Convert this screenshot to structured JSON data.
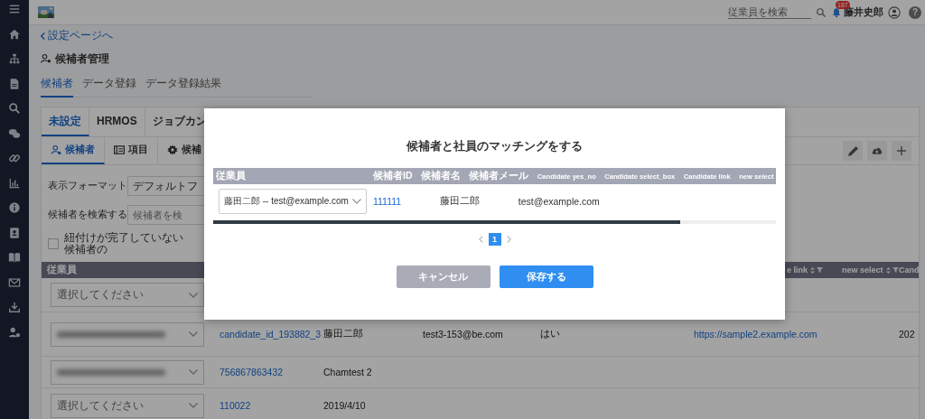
{
  "topbar": {
    "search_placeholder": "従業員を検索",
    "notification_count": "187",
    "user_name": "藤井史郎",
    "help": "?"
  },
  "back_link": "設定ページへ",
  "page_title": "候補者管理",
  "tabs": [
    {
      "label": "候補者",
      "selected": true
    },
    {
      "label": "データ登録",
      "selected": false
    },
    {
      "label": "データ登録結果",
      "selected": false
    }
  ],
  "source_tabs": [
    {
      "label": "未設定",
      "selected": true
    },
    {
      "label": "HRMOS",
      "selected": false
    },
    {
      "label": "ジョブカン",
      "selected": false
    }
  ],
  "view_tabs": [
    {
      "label": "候補者",
      "kind": "person",
      "selected": true
    },
    {
      "label": "項目",
      "kind": "list",
      "selected": false
    },
    {
      "label": "候補",
      "kind": "gear",
      "selected": false
    }
  ],
  "form": {
    "format_label": "表示フォーマット",
    "format_value": "デフォルトフ",
    "search_label": "候補者を検索する",
    "search_placeholder": "候補者を検",
    "unlinked_filter": {
      "label": "紐付けが完了していない候補者の",
      "checked": false
    }
  },
  "table": {
    "columns": [
      {
        "label": "従業員",
        "sortable": false
      },
      {
        "label": "e link",
        "sortable": true
      },
      {
        "label": "new select",
        "sortable": true
      },
      {
        "label": "Cand",
        "sortable": false
      }
    ],
    "rows": [
      {
        "employee": {
          "kind": "placeholder",
          "text": "選択してください"
        }
      },
      {
        "employee": {
          "kind": "redacted"
        },
        "candidate_id": "candidate_id_193882_3",
        "candidate_name": "藤田二郎",
        "candidate_email": "test3-153@be.com",
        "yes_no": "はい",
        "link": "https://sample2.example.com",
        "column_9": "202"
      },
      {
        "employee": {
          "kind": "redacted"
        },
        "candidate_id": "756867863432",
        "candidate_name": "Chamtest 2"
      },
      {
        "employee": {
          "kind": "placeholder",
          "text": "選択してください"
        },
        "candidate_id": "110022",
        "candidate_name": "2019/4/10"
      }
    ]
  },
  "modal": {
    "title": "候補者と社員のマッチングをする",
    "columns": [
      "従業員",
      "候補者ID",
      "候補者名",
      "候補者メール",
      "Candidate yes_no",
      "Candidate select_box",
      "Candidate link",
      "new select"
    ],
    "rows": [
      {
        "employee": "藤田二郎 -- test@example.com",
        "candidate_id": "111111",
        "candidate_name": "藤田二郎",
        "candidate_email": "test@example.com"
      }
    ],
    "pages": [
      {
        "label": "1",
        "selected": true
      }
    ],
    "buttons": [
      {
        "label": "キャンセル",
        "kind": "secondary"
      },
      {
        "label": "保存する",
        "kind": "primary"
      }
    ]
  }
}
